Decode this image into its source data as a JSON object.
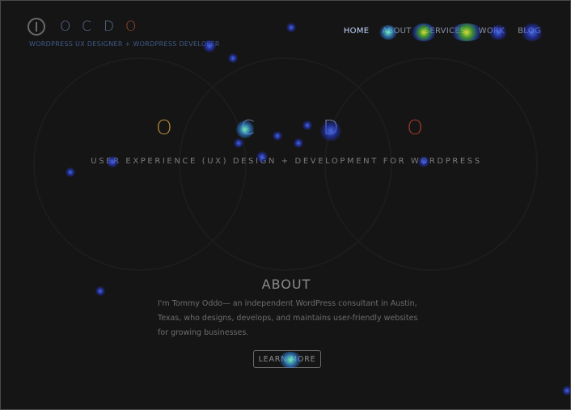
{
  "header": {
    "logo_letters": [
      "O",
      "C",
      "D",
      "O"
    ],
    "logo_letter_colors": [
      "#5a6a90",
      "#5a6a90",
      "#5a6a90",
      "#9a4a2a"
    ],
    "tagline": "WORDPRESS UX DESIGNER + WORDPRESS DEVELOPER"
  },
  "nav": {
    "items": [
      {
        "label": "HOME",
        "active": true
      },
      {
        "label": "ABOUT",
        "active": false
      },
      {
        "label": "SERVICES",
        "active": false
      },
      {
        "label": "WORK",
        "active": false
      },
      {
        "label": "BLOG",
        "active": false
      }
    ]
  },
  "hero": {
    "letters": [
      "O",
      "C",
      "D",
      "O"
    ],
    "letter_colors": [
      "#b58a3a",
      "#6a7aa0",
      "#6a7aa0",
      "#a23a2a"
    ],
    "subtitle": "USER EXPERIENCE (UX) DESIGN + DEVELOPMENT FOR WORDPRESS"
  },
  "about": {
    "title": "ABOUT",
    "text": "I'm Tommy Oddo— an independent WordPress consultant in Austin, Texas, who designs, develops, and maintains user-friendly websites for growing businesses.",
    "button_label": "LEARN MORE"
  },
  "colors": {
    "background": "#151515",
    "accent_orange": "#b58a3a",
    "accent_red": "#a23a2a"
  }
}
